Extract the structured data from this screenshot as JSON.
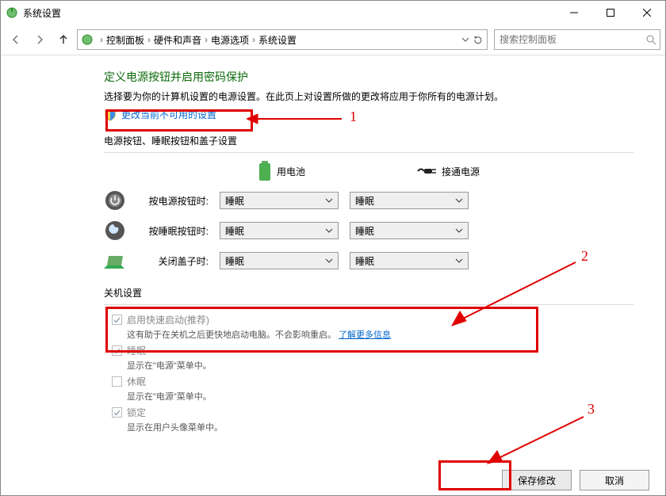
{
  "window": {
    "title": "系统设置"
  },
  "breadcrumb": {
    "items": [
      "控制面板",
      "硬件和声音",
      "电源选项",
      "系统设置"
    ]
  },
  "search": {
    "placeholder": "搜索控制面板"
  },
  "page": {
    "heading": "定义电源按钮并启用密码保护",
    "description": "选择要为你的计算机设置的电源设置。在此页上对设置所做的更改将应用于你所有的电源计划。",
    "changeLink": "更改当前不可用的设置",
    "section1": "电源按钮、睡眠按钮和盖子设置",
    "modes": {
      "battery": "用电池",
      "ac": "接通电源"
    },
    "rows": {
      "power": {
        "label": "按电源按钮时:",
        "battery": "睡眠",
        "ac": "睡眠"
      },
      "sleep": {
        "label": "按睡眠按钮时:",
        "battery": "睡眠",
        "ac": "睡眠"
      },
      "lid": {
        "label": "关闭盖子时:",
        "battery": "睡眠",
        "ac": "睡眠"
      }
    },
    "section2": "关机设置",
    "shutdown": {
      "fastStartup": {
        "label": "启用快速启动(推荐)",
        "desc": "这有助于在关机之后更快地启动电脑。不会影响重启。",
        "moreLink": "了解更多信息",
        "checked": true
      },
      "sleepMenu": {
        "label": "睡眠",
        "desc": "显示在\"电源\"菜单中。",
        "checked": true
      },
      "hibernate": {
        "label": "休眠",
        "desc": "显示在\"电源\"菜单中。",
        "checked": false
      },
      "lock": {
        "label": "锁定",
        "desc": "显示在用户头像菜单中。",
        "checked": true
      }
    }
  },
  "footer": {
    "save": "保存修改",
    "cancel": "取消"
  },
  "annotations": {
    "n1": "1",
    "n2": "2",
    "n3": "3"
  }
}
